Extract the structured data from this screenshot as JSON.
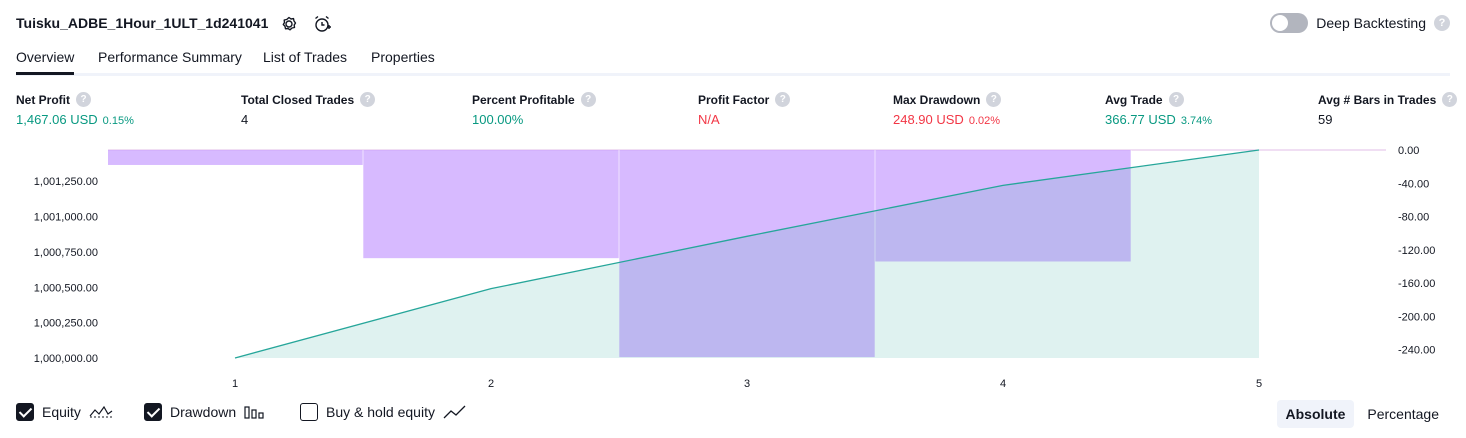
{
  "header": {
    "title": "Tuisku_ADBE_1Hour_1ULT_1d241041",
    "icons": [
      "settings-icon",
      "add-alert-icon"
    ],
    "deep_backtesting_label": "Deep Backtesting",
    "deep_backtesting_enabled": false,
    "help_glyph": "?"
  },
  "tabs": [
    {
      "label": "Overview",
      "active": true
    },
    {
      "label": "Performance Summary",
      "active": false
    },
    {
      "label": "List of Trades",
      "active": false
    },
    {
      "label": "Properties",
      "active": false
    }
  ],
  "metrics": [
    {
      "label": "Net Profit",
      "value": "1,467.06 USD",
      "pct": "0.15%",
      "color": "#089981"
    },
    {
      "label": "Total Closed Trades",
      "value": "4",
      "pct": "",
      "color": "#131722"
    },
    {
      "label": "Percent Profitable",
      "value": "100.00%",
      "pct": "",
      "color": "#089981"
    },
    {
      "label": "Profit Factor",
      "value": "N/A",
      "pct": "",
      "color": "#f23645"
    },
    {
      "label": "Max Drawdown",
      "value": "248.90 USD",
      "pct": "0.02%",
      "color": "#f23645"
    },
    {
      "label": "Avg Trade",
      "value": "366.77 USD",
      "pct": "3.74%",
      "color": "#089981"
    },
    {
      "label": "Avg # Bars in Trades",
      "value": "59",
      "pct": "",
      "color": "#131722"
    }
  ],
  "chart_data": {
    "type": "line",
    "x": [
      1,
      2,
      3,
      4,
      5
    ],
    "equity_series": {
      "name": "Equity",
      "values": [
        1000000,
        1000490,
        1000860,
        1001220,
        1001470
      ],
      "color": "#26a69a"
    },
    "drawdown_series": {
      "name": "Drawdown",
      "values": [
        -18,
        -130,
        -248.9,
        -134,
        0
      ],
      "color": "#c8a0ff"
    },
    "buy_hold_series": {
      "name": "Buy & hold equity",
      "values": [],
      "color": "#131722"
    },
    "left_axis": {
      "ticks": [
        "1,000,000.00",
        "1,000,250.00",
        "1,000,500.00",
        "1,000,750.00",
        "1,001,000.00",
        "1,001,250.00"
      ],
      "tick_values": [
        1000000,
        1000250,
        1000500,
        1000750,
        1001000,
        1001250
      ],
      "ylim": [
        1000000,
        1001470
      ]
    },
    "right_axis": {
      "ticks": [
        "0.00",
        "-40.00",
        "-80.00",
        "-120.00",
        "-160.00",
        "-200.00",
        "-240.00"
      ],
      "tick_values": [
        0,
        -40,
        -80,
        -120,
        -160,
        -200,
        -240
      ],
      "ylim": [
        -250,
        0
      ]
    },
    "x_ticks": [
      "1",
      "2",
      "3",
      "4",
      "5"
    ]
  },
  "legend": [
    {
      "label": "Equity",
      "checked": true,
      "icon": "equity-line-icon"
    },
    {
      "label": "Drawdown",
      "checked": true,
      "icon": "drawdown-bars-icon"
    },
    {
      "label": "Buy & hold equity",
      "checked": false,
      "icon": "buy-hold-line-icon"
    }
  ],
  "modes": [
    {
      "label": "Absolute",
      "active": true
    },
    {
      "label": "Percentage",
      "active": false
    }
  ]
}
